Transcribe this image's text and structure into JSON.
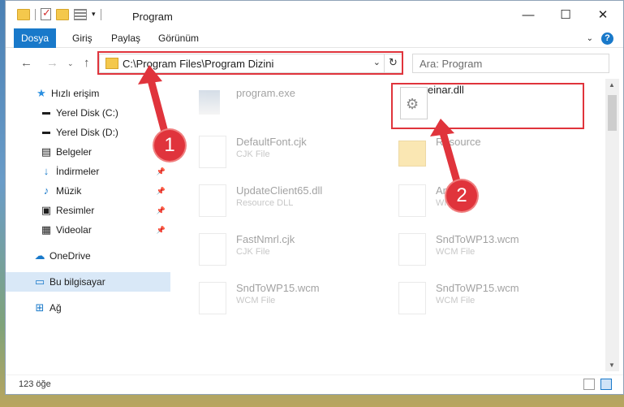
{
  "window": {
    "title": "Program"
  },
  "ribbon": {
    "tabs": [
      "Dosya",
      "Giriş",
      "Paylaş",
      "Görünüm"
    ]
  },
  "address": {
    "path": "C:\\Program Files\\Program Dizini"
  },
  "search": {
    "placeholder": "Ara: Program"
  },
  "sidebar": {
    "items": [
      {
        "label": "Hızlı erişim",
        "icon": "star-icon"
      },
      {
        "label": "Yerel Disk (C:)",
        "icon": "drive-icon"
      },
      {
        "label": "Yerel Disk (D:)",
        "icon": "drive-icon"
      },
      {
        "label": "Belgeler",
        "icon": "document-icon"
      },
      {
        "label": "İndirmeler",
        "icon": "download-icon"
      },
      {
        "label": "Müzik",
        "icon": "music-icon"
      },
      {
        "label": "Resimler",
        "icon": "pictures-icon"
      },
      {
        "label": "Videolar",
        "icon": "video-icon"
      },
      {
        "label": "OneDrive",
        "icon": "cloud-icon"
      },
      {
        "label": "Bu bilgisayar",
        "icon": "computer-icon"
      },
      {
        "label": "Ağ",
        "icon": "network-icon"
      }
    ]
  },
  "files": [
    {
      "name": "program.exe",
      "type": ""
    },
    {
      "name": "einar.dll",
      "type": ""
    },
    {
      "name": "DefaultFont.cjk",
      "type": "CJK File"
    },
    {
      "name": "Resource",
      "type": ""
    },
    {
      "name": "UpdateClient65.dll",
      "type": "Resource DLL"
    },
    {
      "name": "Archived",
      "type": "WIM File"
    },
    {
      "name": "FastNmrl.cjk",
      "type": "CJK File"
    },
    {
      "name": "SndToWP13.wcm",
      "type": "WCM File"
    },
    {
      "name": "SndToWP15.wcm",
      "type": "WCM File"
    },
    {
      "name": "SndToWP15.wcm",
      "type": "WCM File"
    }
  ],
  "status": {
    "count": "123 öğe"
  },
  "annotations": [
    "1",
    "2"
  ],
  "colors": {
    "accent": "#1979ca",
    "highlight": "#e0343c",
    "folder": "#f4c84c"
  }
}
